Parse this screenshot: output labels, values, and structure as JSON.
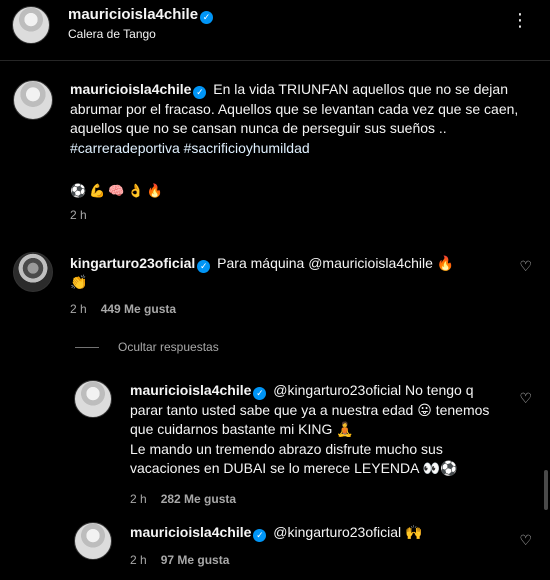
{
  "header": {
    "username": "mauricioisla4chile",
    "location": "Calera de Tango",
    "more_icon": "⋮"
  },
  "caption": {
    "username": "mauricioisla4chile",
    "text": "En la vida TRIUNFAN aquellos que no se dejan abrumar por el fracaso. Aquellos que se levantan cada vez que se caen, aquellos que no se cansan nunca de perseguir sus sueños ..",
    "hashtags": "#carreradeportiva #sacrificioyhumildad",
    "emojis": "⚽💪🧠👌🔥",
    "time": "2 h"
  },
  "comment1": {
    "username": "kingarturo23oficial",
    "text": "Para máquina @mauricioisla4chile 🔥",
    "text_line2": "👏",
    "time": "2 h",
    "likes": "449 Me gusta"
  },
  "hide_replies": "Ocultar respuestas",
  "reply1": {
    "username": "mauricioisla4chile",
    "text": "@kingarturo23oficial No tengo q parar tanto usted sabe que ya a nuestra edad 😛 tenemos que cuidarnos bastante mi KING 🧘",
    "text_line2": "Le mando un tremendo abrazo disfrute mucho sus vacaciones en DUBAI se lo merece LEYENDA 👀⚽",
    "time": "2 h",
    "likes": "282 Me gusta"
  },
  "reply2": {
    "username": "mauricioisla4chile",
    "text": "@kingarturo23oficial 🙌",
    "time": "2 h",
    "likes": "97 Me gusta"
  },
  "icons": {
    "verified": "✓",
    "heart": "♡"
  },
  "colors": {
    "background": "#000000",
    "verified_badge": "#0095f6",
    "meta_text": "#a8a8a8"
  }
}
